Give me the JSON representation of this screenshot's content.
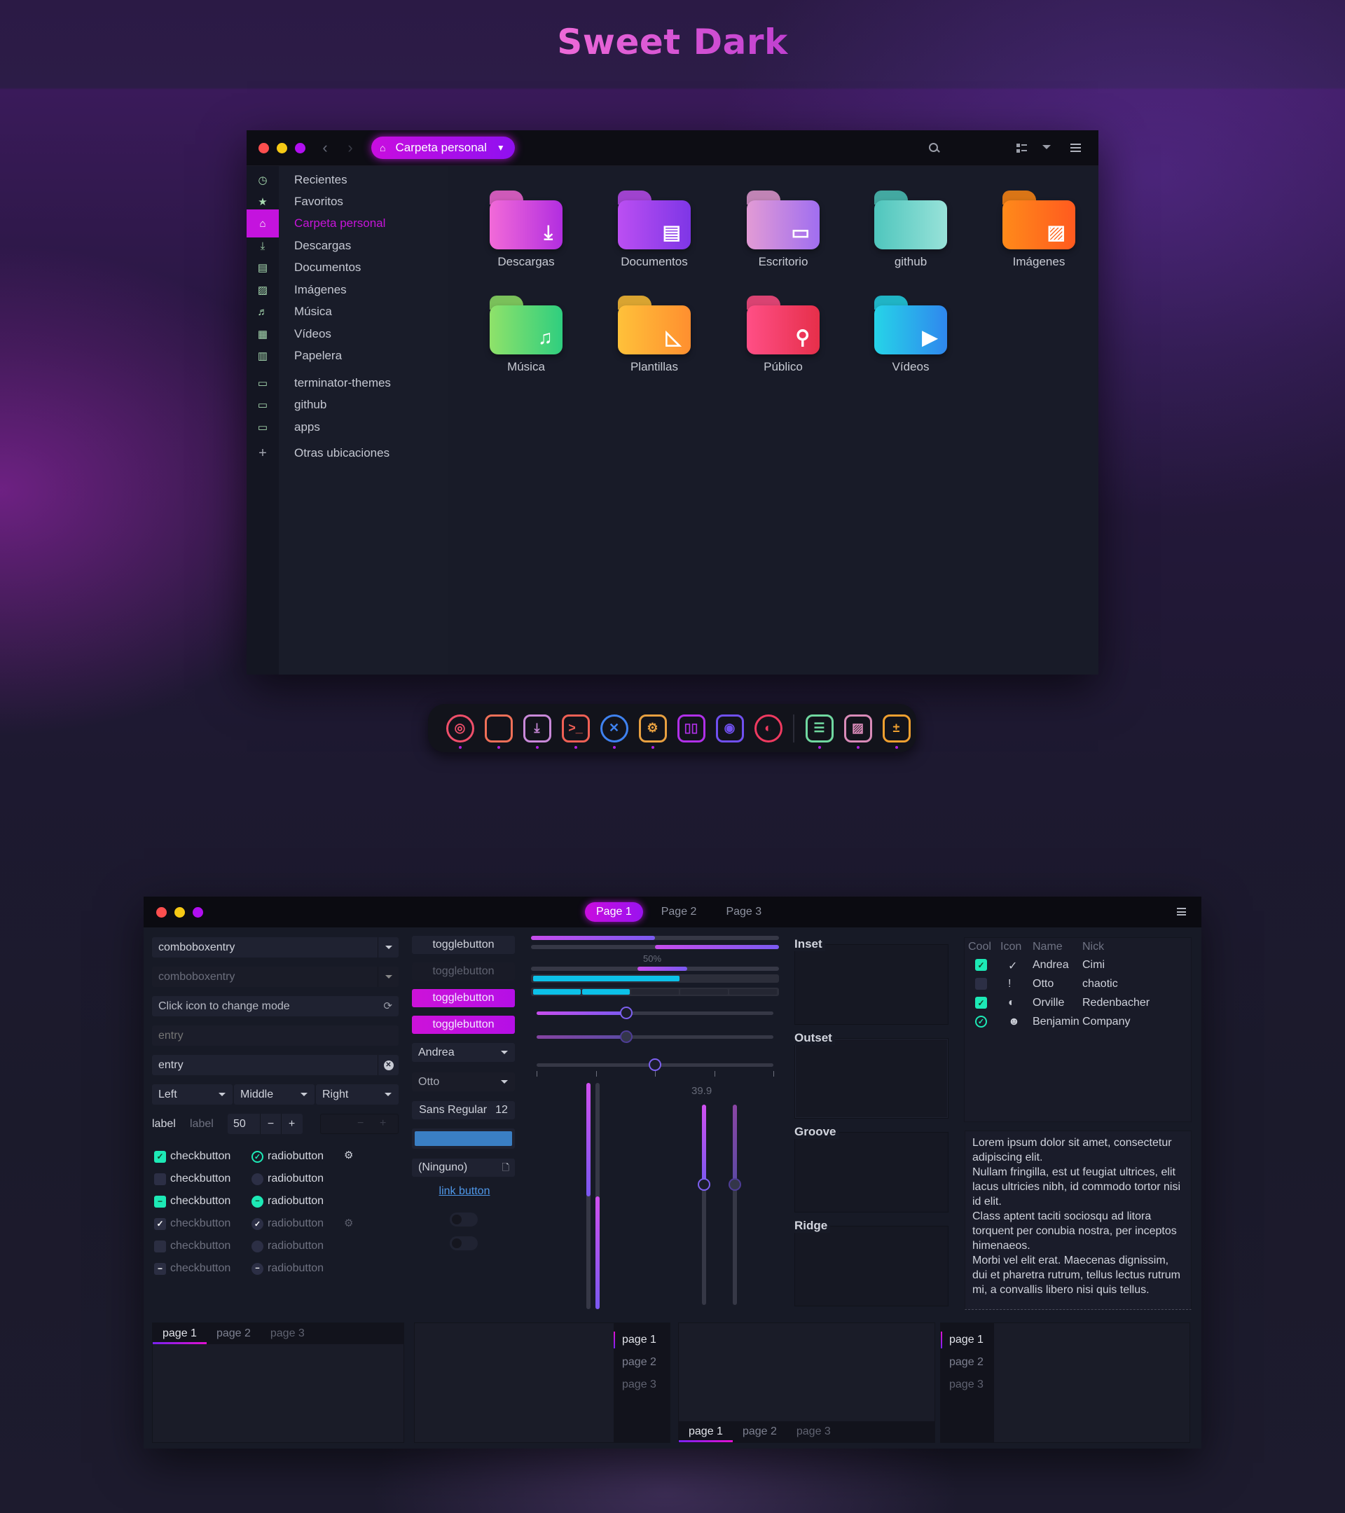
{
  "page_title": "Sweet Dark",
  "file_manager": {
    "path_label": "Carpeta personal",
    "icons": {
      "back": "chevron-left-icon",
      "forward": "chevron-right-icon",
      "home": "home-icon",
      "search": "search-icon",
      "view": "view-list-icon",
      "view_menu": "chevron-down-icon",
      "menu": "hamburger-menu-icon"
    },
    "sidebar": [
      {
        "label": "Recientes",
        "icon": "clock-icon",
        "glyph": "◷"
      },
      {
        "label": "Favoritos",
        "icon": "star-icon",
        "glyph": "★"
      },
      {
        "label": "Carpeta personal",
        "icon": "home-icon",
        "glyph": "⌂",
        "active": true
      },
      {
        "label": "Descargas",
        "icon": "download-icon",
        "glyph": "⤓"
      },
      {
        "label": "Documentos",
        "icon": "document-icon",
        "glyph": "▤"
      },
      {
        "label": "Imágenes",
        "icon": "image-icon",
        "glyph": "▨"
      },
      {
        "label": "Música",
        "icon": "music-icon",
        "glyph": "♬"
      },
      {
        "label": "Vídeos",
        "icon": "film-icon",
        "glyph": "▦"
      },
      {
        "label": "Papelera",
        "icon": "trash-icon",
        "glyph": "▥"
      },
      {
        "label": "terminator-themes",
        "icon": "folder-icon",
        "glyph": "▭"
      },
      {
        "label": "github",
        "icon": "folder-icon",
        "glyph": "▭"
      },
      {
        "label": "apps",
        "icon": "folder-icon",
        "glyph": "▭"
      },
      {
        "label": "Otras ubicaciones",
        "icon": "plus-icon",
        "glyph": "+"
      }
    ],
    "folders": [
      {
        "name": "Descargas",
        "icon": "download-icon",
        "glyph": "⤓",
        "colors": [
          "#f26ad8",
          "#b22ee0"
        ]
      },
      {
        "name": "Documentos",
        "icon": "document-icon",
        "glyph": "▤",
        "colors": [
          "#bb4ff2",
          "#7e36e6"
        ]
      },
      {
        "name": "Escritorio",
        "icon": "desktop-icon",
        "glyph": "▭",
        "colors": [
          "#e29bd5",
          "#a06ef0"
        ]
      },
      {
        "name": "github",
        "icon": "folder-icon",
        "glyph": "",
        "colors": [
          "#4fc6bd",
          "#98e2d9"
        ]
      },
      {
        "name": "Imágenes",
        "icon": "image-icon",
        "glyph": "▨",
        "colors": [
          "#ff8a1a",
          "#ff5a1f"
        ]
      },
      {
        "name": "Música",
        "icon": "music-icon",
        "glyph": "♫",
        "colors": [
          "#8fe26a",
          "#2fce7f"
        ]
      },
      {
        "name": "Plantillas",
        "icon": "template-icon",
        "glyph": "◺",
        "colors": [
          "#ffc13a",
          "#ff8f2f"
        ]
      },
      {
        "name": "Público",
        "icon": "person-icon",
        "glyph": "⚲",
        "colors": [
          "#ff4f86",
          "#e62f4a"
        ]
      },
      {
        "name": "Vídeos",
        "icon": "video-icon",
        "glyph": "▶",
        "colors": [
          "#26d4e8",
          "#2f87ee"
        ]
      }
    ]
  },
  "dock": {
    "apps": [
      {
        "name": "chrome-icon",
        "glyph": "◎",
        "color": "#ef4f6a",
        "running": true
      },
      {
        "name": "files-icon",
        "glyph": "",
        "color": "#f07058",
        "running": true
      },
      {
        "name": "software-icon",
        "glyph": "⤓",
        "color": "#c989d9",
        "running": true
      },
      {
        "name": "terminal-icon",
        "glyph": ">_",
        "color": "#f06055",
        "running": true
      },
      {
        "name": "vscode-icon",
        "glyph": "✕",
        "color": "#3f82f0",
        "running": true
      },
      {
        "name": "settings-icon",
        "glyph": "⚙",
        "color": "#e8a040",
        "running": true
      },
      {
        "name": "switch-icon",
        "glyph": "▯▯",
        "color": "#b030e8",
        "running": false
      },
      {
        "name": "camera-icon",
        "glyph": "◉",
        "color": "#7050f0",
        "running": false
      },
      {
        "name": "firefox-icon",
        "glyph": "◐",
        "color": "#ef3a60",
        "running": false
      },
      {
        "name": "todo-icon",
        "glyph": "☰",
        "color": "#70d8a0",
        "running": true
      },
      {
        "name": "image-viewer-icon",
        "glyph": "▨",
        "color": "#d98bb8",
        "running": true
      },
      {
        "name": "calculator-icon",
        "glyph": "±",
        "color": "#f0a030",
        "running": true
      }
    ]
  },
  "widget_factory": {
    "stack_tabs": [
      "Page 1",
      "Page 2",
      "Page 3"
    ],
    "active_stack_tab": 0,
    "combo1": "comboboxentry",
    "combo2": "comboboxentry",
    "mode_entry": "Click icon to change mode",
    "entry_placeholder": "entry",
    "entry_value": "entry",
    "align_combos": [
      "Left",
      "Middle",
      "Right"
    ],
    "label1": "label",
    "label2": "label",
    "spin_value": "50",
    "spin_minus": "−",
    "spin_plus": "+",
    "checkbuttons": [
      {
        "label": "checkbutton",
        "state": "checked",
        "enabled": true
      },
      {
        "label": "checkbutton",
        "state": "unchecked",
        "enabled": true
      },
      {
        "label": "checkbutton",
        "state": "mixed",
        "enabled": true
      },
      {
        "label": "checkbutton",
        "state": "checked",
        "enabled": false
      },
      {
        "label": "checkbutton",
        "state": "unchecked",
        "enabled": false
      },
      {
        "label": "checkbutton",
        "state": "mixed",
        "enabled": false
      }
    ],
    "radiobuttons": [
      {
        "label": "radiobutton",
        "state": "checked",
        "enabled": true
      },
      {
        "label": "radiobutton",
        "state": "unchecked",
        "enabled": true
      },
      {
        "label": "radiobutton",
        "state": "mixed",
        "enabled": true
      },
      {
        "label": "radiobutton",
        "state": "checked",
        "enabled": false
      },
      {
        "label": "radiobutton",
        "state": "unchecked",
        "enabled": false
      },
      {
        "label": "radiobutton",
        "state": "mixed",
        "enabled": false
      }
    ],
    "togglebuttons": [
      {
        "label": "togglebutton",
        "state": "normal"
      },
      {
        "label": "togglebutton",
        "state": "disabled"
      },
      {
        "label": "togglebutton",
        "state": "active"
      },
      {
        "label": "togglebutton",
        "state": "active"
      }
    ],
    "combo_andrea": "Andrea",
    "combo_otto": "Otto",
    "font_button": {
      "name": "Sans Regular",
      "size": "12"
    },
    "color_button": "#3a7fc4",
    "file_button": "(Ninguno)",
    "link_button": "link button",
    "switches": [
      false,
      false
    ],
    "progress": {
      "bar1": 0.5,
      "bar2_start": 0.5,
      "bar3_label": "50%",
      "bar3_pulse": [
        0.43,
        0.63
      ],
      "cyan_level": 0.6,
      "segments_total": 5,
      "segments_filled": 2
    },
    "sliders": {
      "h1": 0.38,
      "h2": 0.38,
      "h3": 0.5,
      "v_level_left": 0.5,
      "v_level_right": 0.5,
      "v_scale_value": "39.9",
      "v_scale1": 0.4,
      "v_scale2": 0.4
    },
    "frames": [
      "Inset",
      "Outset",
      "Groove",
      "Ridge"
    ],
    "tree": {
      "headers": [
        "Cool",
        "Icon",
        "Name",
        "Nick"
      ],
      "rows": [
        {
          "cool": "checked",
          "icon": "check-icon",
          "glyph": "✓",
          "name": "Andrea",
          "nick": "Cimi"
        },
        {
          "cool": "unchecked",
          "icon": "exclamation-icon",
          "glyph": "!",
          "name": "Otto",
          "nick": "chaotic"
        },
        {
          "cool": "checked",
          "icon": "moon-icon",
          "glyph": "◐",
          "name": "Orville",
          "nick": "Redenbacher"
        },
        {
          "cool": "radio",
          "icon": "monkey-icon",
          "glyph": "☻",
          "name": "Benjamin",
          "nick": "Company"
        }
      ]
    },
    "text_view": "Lorem ipsum dolor sit amet, consectetur adipiscing elit.\nNullam fringilla, est ut feugiat ultrices, elit lacus ultricies nibh, id commodo tortor nisi id elit.\nClass aptent taciti sociosqu ad litora torquent per conubia nostra, per inceptos himenaeos.\nMorbi vel elit erat. Maecenas dignissim, dui et pharetra rutrum, tellus lectus rutrum mi, a convallis libero nisi quis tellus.",
    "notebooks": [
      {
        "position": "top",
        "tabs": [
          "page 1",
          "page 2",
          "page 3"
        ],
        "active": 0
      },
      {
        "position": "right",
        "tabs": [
          "page 1",
          "page 2",
          "page 3"
        ],
        "active": 0
      },
      {
        "position": "bottom",
        "tabs": [
          "page 1",
          "page 2",
          "page 3"
        ],
        "active": 0
      },
      {
        "position": "left",
        "tabs": [
          "page 1",
          "page 2",
          "page 3"
        ],
        "active": 0
      }
    ]
  }
}
